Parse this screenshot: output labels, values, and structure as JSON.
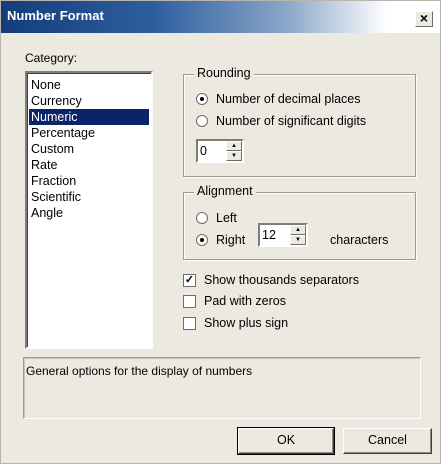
{
  "window": {
    "title": "Number Format",
    "close_glyph": "×"
  },
  "category": {
    "label": "Category:",
    "items": [
      "None",
      "Currency",
      "Numeric",
      "Percentage",
      "Custom",
      "Rate",
      "Fraction",
      "Scientific",
      "Angle"
    ],
    "selected": "Numeric"
  },
  "rounding": {
    "title": "Rounding",
    "option_decimal": "Number of decimal places",
    "option_significant": "Number of significant digits",
    "selected": "decimal",
    "value": "0"
  },
  "alignment": {
    "title": "Alignment",
    "option_left": "Left",
    "option_right": "Right",
    "selected": "right",
    "width_value": "12",
    "characters_label": "characters"
  },
  "options": {
    "thousands_label": "Show thousands separators",
    "thousands_checked": true,
    "pad_label": "Pad with zeros",
    "pad_checked": false,
    "plus_label": "Show plus sign",
    "plus_checked": false
  },
  "description": "General options for the display of numbers",
  "buttons": {
    "ok": "OK",
    "cancel": "Cancel"
  },
  "colors": {
    "selection": "#0a246a",
    "dialog_bg": "#ece9e1"
  }
}
